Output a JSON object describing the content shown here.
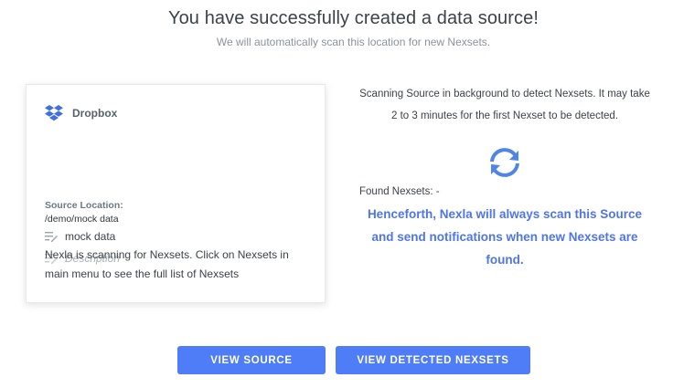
{
  "header": {
    "title": "You have successfully created a data source!",
    "subtitle": "We will automatically scan this location for new Nexsets."
  },
  "source_card": {
    "provider_icon": "dropbox-icon",
    "provider_name": "Dropbox",
    "name_icon": "edit-lines-icon",
    "name_value": "mock data",
    "description_placeholder": "Description",
    "location_label": "Source Location:",
    "location_value": "/demo/mock data",
    "note": "Nexla is scanning for Nexsets. Click on Nexsets in main menu to see the full list of Nexsets"
  },
  "scan_panel": {
    "status_text": "Scanning Source in background to detect Nexsets. It may take 2 to 3 minutes for the first Nexset to be detected.",
    "status_icon": "refresh-icon",
    "found_label": "Found Nexsets: -",
    "notify_text": "Henceforth, Nexla will always scan this Source and send notifications when new Nexsets are found."
  },
  "actions": {
    "view_source": "VIEW SOURCE",
    "view_nexsets": "VIEW DETECTED NEXSETS"
  },
  "colors": {
    "accent": "#4f7cf7",
    "accent_text": "#4f75ea",
    "dropbox": "#3f6fe0"
  }
}
